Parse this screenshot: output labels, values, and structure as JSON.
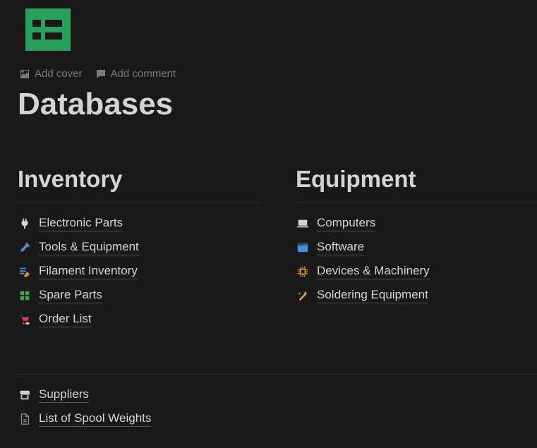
{
  "page": {
    "title": "Databases",
    "actions": {
      "add_cover": "Add cover",
      "add_comment": "Add comment"
    }
  },
  "columns": [
    {
      "heading": "Inventory",
      "items": [
        {
          "icon": "plug-icon",
          "label": "Electronic Parts",
          "color": "#d4d4d4"
        },
        {
          "icon": "hammer-icon",
          "label": "Tools & Equipment",
          "color": "#4a8fd8"
        },
        {
          "icon": "list-edit-icon",
          "label": "Filament Inventory",
          "color": "#4a8fd8"
        },
        {
          "icon": "puzzle-icon",
          "label": "Spare Parts",
          "color": "#3fa657"
        },
        {
          "icon": "cart-share-icon",
          "label": "Order List",
          "color": "#d64545"
        }
      ]
    },
    {
      "heading": "Equipment",
      "items": [
        {
          "icon": "laptop-icon",
          "label": "Computers",
          "color": "#d4d4d4"
        },
        {
          "icon": "window-icon",
          "label": "Software",
          "color": "#4a8fd8"
        },
        {
          "icon": "chip-icon",
          "label": "Devices & Machinery",
          "color": "#e8a33d"
        },
        {
          "icon": "wand-icon",
          "label": "Soldering Equipment",
          "color": "#e8a33d"
        }
      ]
    }
  ],
  "bottom_items": [
    {
      "icon": "store-icon",
      "label": "Suppliers",
      "color": "#d4d4d4"
    },
    {
      "icon": "file-icon",
      "label": "List of Spool Weights",
      "color": "#8a8a8a"
    }
  ]
}
